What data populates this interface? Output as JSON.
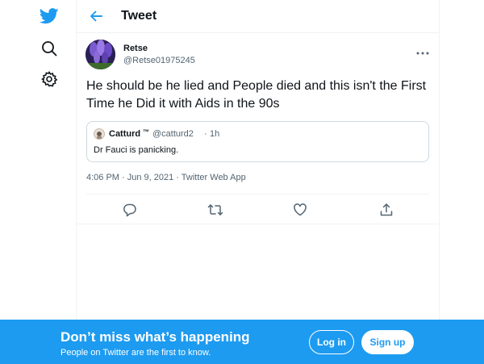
{
  "header": {
    "title": "Tweet"
  },
  "tweet": {
    "author_name": "Retse",
    "author_handle": "@Retse01975245",
    "text": "He should be he lied and People died and this isn't the First Time he Did it with Aids in the 90s",
    "timestamp": "4:06 PM · Jun 9, 2021 · Twitter Web App"
  },
  "quote": {
    "author_name": "Catturd",
    "badge": "™",
    "author_handle": "@catturd2",
    "separator": "·",
    "time": "1h",
    "text": "Dr Fauci is panicking."
  },
  "banner": {
    "title": "Don’t miss what’s happening",
    "subtitle": "People on Twitter are the first to know.",
    "login_label": "Log in",
    "signup_label": "Sign up"
  },
  "colors": {
    "accent": "#1d9bf0",
    "text_primary": "#0f1419",
    "text_secondary": "#536471",
    "border": "#eff3f4"
  },
  "icons": {
    "logo": "twitter-bird-icon",
    "explore": "search-icon",
    "settings": "gear-icon",
    "back": "back-arrow-icon",
    "more": "more-icon",
    "reply": "reply-icon",
    "retweet": "retweet-icon",
    "like": "like-icon",
    "share": "share-icon"
  }
}
